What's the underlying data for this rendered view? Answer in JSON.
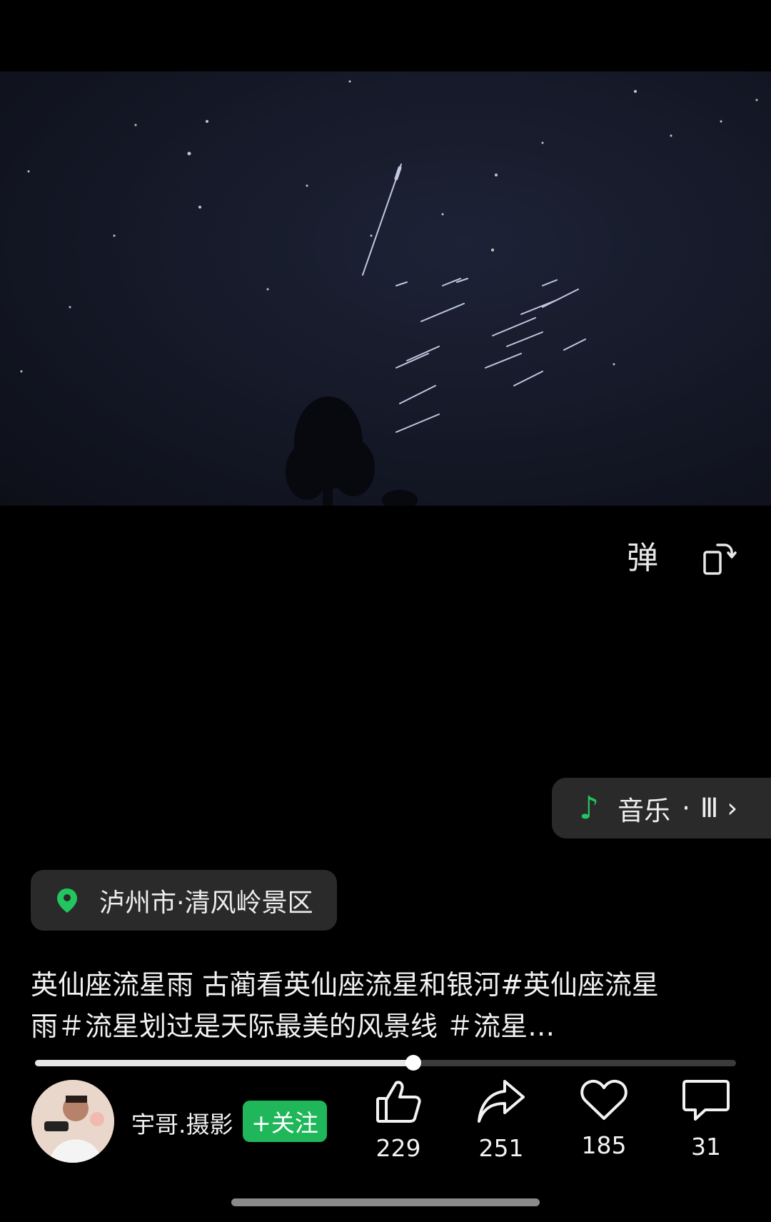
{
  "video": {
    "description_icon": "meteor-shower-video"
  },
  "controls": {
    "danmaku_label": "弹",
    "rotate_icon": "rotate-screen-icon"
  },
  "music": {
    "label": "音乐",
    "separator": "·",
    "bars": "Ⅲ",
    "chevron": "›"
  },
  "location": {
    "text": "泸州市·清风岭景区"
  },
  "caption": {
    "line1": "英仙座流星雨 古蔺看英仙座流星和银河#英仙座流星",
    "line2": "雨＃流星划过是天际最美的风景线 ＃流星…"
  },
  "progress": {
    "fraction": 0.54
  },
  "author": {
    "name": "宇哥.摄影",
    "follow_label": "+关注"
  },
  "actions": {
    "like_count": "229",
    "share_count": "251",
    "favorite_count": "185",
    "comment_count": "31"
  },
  "colors": {
    "accent_green": "#1fb75a",
    "note_green": "#22c55e"
  }
}
